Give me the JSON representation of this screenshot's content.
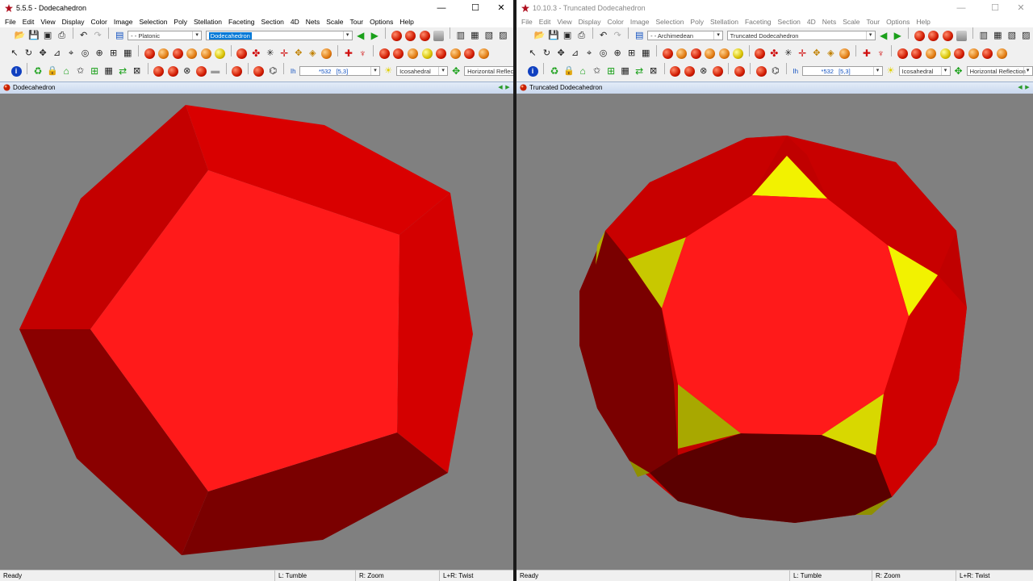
{
  "colors": {
    "face_red_front": "#ff1a1a",
    "face_red_mid": "#d90000",
    "face_red_dark": "#7a0000",
    "face_yellow": "#f2f200",
    "background": "#808080",
    "selection_blue": "#0078d7"
  },
  "menu": [
    "File",
    "Edit",
    "View",
    "Display",
    "Color",
    "Image",
    "Selection",
    "Poly",
    "Stellation",
    "Faceting",
    "Section",
    "4D",
    "Nets",
    "Scale",
    "Tour",
    "Options",
    "Help"
  ],
  "left": {
    "window_title": "5.5.5 - Dodecahedron",
    "category": "- - Platonic",
    "polyhedron": "Dodecahedron",
    "symmetry_symbol": "Ih",
    "symmetry_code": "*532",
    "symmetry_bracket": "[5,3]",
    "symmetry_group": "Icosahedral",
    "symmetry_op": "Horizontal Reflection",
    "pane_title": "Dodecahedron",
    "status": {
      "ready": "Ready",
      "left_mouse": "L: Tumble",
      "right_mouse": "R: Zoom",
      "both_mouse": "L+R: Twist"
    }
  },
  "right": {
    "window_title": "10.10.3 - Truncated Dodecahedron",
    "category": "- - Archimedean",
    "polyhedron": "Truncated Dodecahedron",
    "symmetry_symbol": "Ih",
    "symmetry_code": "*532",
    "symmetry_bracket": "[5,3]",
    "symmetry_group": "Icosahedral",
    "symmetry_op": "Horizontal Reflection",
    "pane_title": "Truncated Dodecahedron",
    "status": {
      "ready": "Ready",
      "left_mouse": "L: Tumble",
      "right_mouse": "R: Zoom",
      "both_mouse": "L+R: Twist"
    }
  },
  "icons": {
    "window_controls": [
      "minimize-icon",
      "maximize-icon",
      "close-icon"
    ],
    "nav": [
      "previous-icon",
      "next-icon"
    ]
  }
}
